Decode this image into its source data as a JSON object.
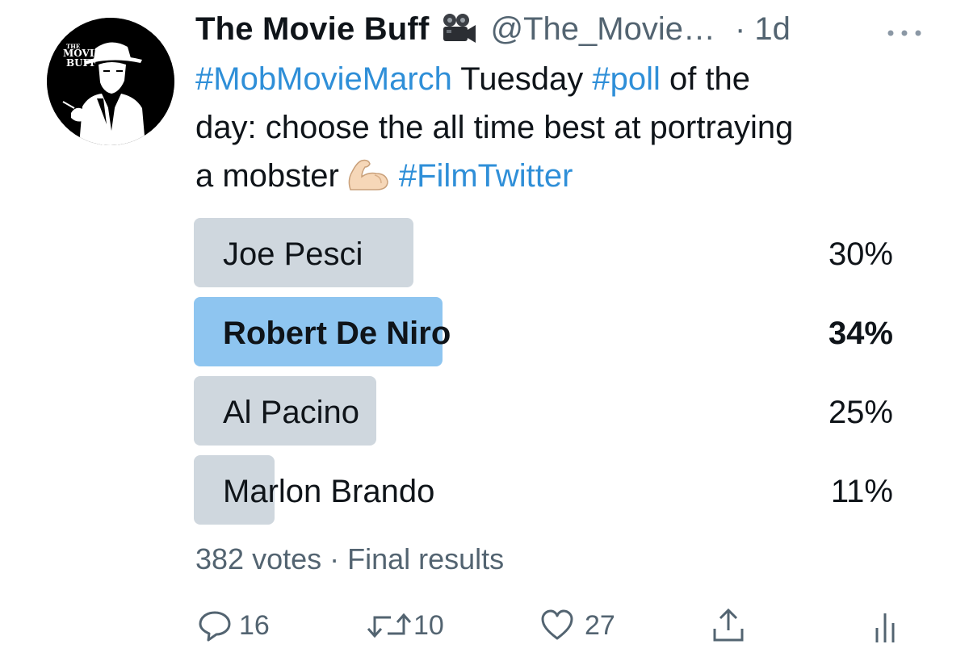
{
  "tweet": {
    "display_name": "The Movie Buff",
    "handle": "@The_Movie…",
    "timestamp": "· 1d",
    "avatar_text": [
      "THE",
      "MOVIE",
      "BUFF"
    ],
    "text_lines": [
      [
        {
          "t": "#MobMovieMarch",
          "tag": true
        },
        {
          "t": " Tuesday ",
          "tag": false
        },
        {
          "t": "#poll",
          "tag": true
        },
        {
          "t": " of the",
          "tag": false
        }
      ],
      [
        {
          "t": "day: choose the all time best at portraying",
          "tag": false
        }
      ],
      [
        {
          "t": "a mobster",
          "tag": false
        },
        {
          "t": "flexed-biceps-emoji",
          "icon": true
        },
        {
          "t": "#FilmTwitter",
          "tag": true
        }
      ]
    ],
    "name_emoji": "movie-camera-emoji",
    "colors": {
      "link": "#2f8fd8",
      "bar": "#cfd7de",
      "bar_winner": "#8ec5f0",
      "secondary": "#536471"
    }
  },
  "poll": {
    "options": [
      {
        "label": "Joe Pesci",
        "percent_text": "30%",
        "percent": 30,
        "winner": false
      },
      {
        "label": "Robert De Niro",
        "percent_text": "34%",
        "percent": 34,
        "winner": true
      },
      {
        "label": "Al Pacino",
        "percent_text": "25%",
        "percent": 25,
        "winner": false
      },
      {
        "label": "Marlon Brando",
        "percent_text": "11%",
        "percent": 11,
        "winner": false
      }
    ],
    "meta": "382 votes · Final results"
  },
  "actions": {
    "reply_count": "16",
    "retweet_count": "10",
    "like_count": "27",
    "icons": [
      "reply-icon",
      "retweet-icon",
      "like-icon",
      "share-icon",
      "analytics-icon"
    ]
  }
}
